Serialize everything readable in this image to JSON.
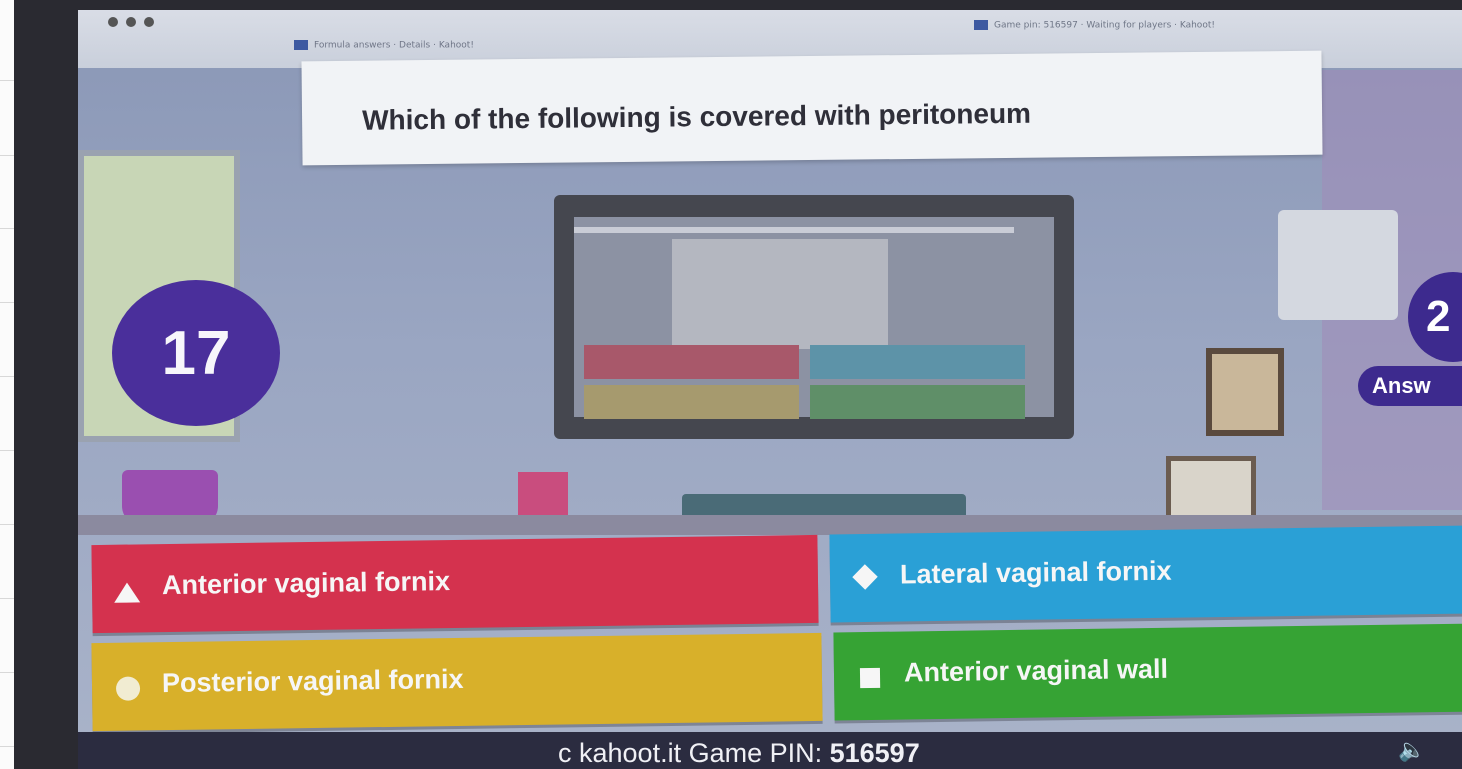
{
  "browser": {
    "tab_left": "Formula answers · Details · Kahoot!",
    "tab_right": "Game pin: 516597 · Waiting for players · Kahoot!"
  },
  "question": {
    "text": "Which of the following  is covered with peritoneum"
  },
  "timer": {
    "seconds": "17"
  },
  "answers_counter": {
    "count": "2",
    "label": "Answ"
  },
  "answers": [
    {
      "label": "Anterior vaginal fornix",
      "symbol": "triangle",
      "color": "#d4324e"
    },
    {
      "label": "Lateral vaginal fornix",
      "symbol": "diamond",
      "color": "#2aa0d6"
    },
    {
      "label": "Posterior vaginal fornix",
      "symbol": "circle",
      "color": "#d8b02a"
    },
    {
      "label": "Anterior vaginal wall",
      "symbol": "square",
      "color": "#36a334"
    }
  ],
  "footer": {
    "prefix": "c kahoot.it Game PIN: ",
    "pin": "516597",
    "speaker_icon": "speaker-icon"
  }
}
